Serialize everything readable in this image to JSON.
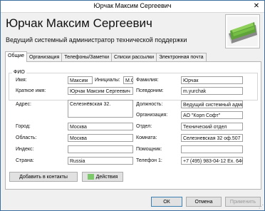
{
  "window": {
    "title": "Юрчак Максим Сергеевич",
    "close_glyph": "✕"
  },
  "header": {
    "name": "Юрчак Максим Сергеевич",
    "job_title": "Ведущий системный администратор технической поддержки"
  },
  "tabs": [
    {
      "label": "Общие",
      "active": true
    },
    {
      "label": "Организация"
    },
    {
      "label": "Телефоны/Заметки"
    },
    {
      "label": "Списки рассылки"
    },
    {
      "label": "Электронная почта"
    }
  ],
  "fio": {
    "legend": "ФИО",
    "first_name_label": "Имя:",
    "first_name": "Максим",
    "initials_label": "Инициалы:",
    "initials": "М.С.",
    "last_name_label": "Фамилия:",
    "last_name": "Юрчак",
    "display_name_label": "Краткое имя:",
    "display_name": "Юрчак Максим Сергеевич",
    "alias_label": "Псевдоним:",
    "alias": "m.yurchak"
  },
  "address": {
    "address_label": "Адрес:",
    "address": "Селезнёвская 32.",
    "city_label": "Город:",
    "city": "Москва",
    "region_label": "Область:",
    "region": "Москва",
    "zip_label": "Индекс:",
    "zip": "",
    "country_label": "Страна:",
    "country": "Russia"
  },
  "work": {
    "position_label": "Должность:",
    "position": "Ведущий системный администратор",
    "org_label": "Организация:",
    "org": "АО \"Корп Софт\"",
    "dept_label": "Отдел:",
    "dept": "Технический отдел",
    "room_label": "Комната:",
    "room": "Селезневская 32 оф.507",
    "assistant_label": "Помощник:",
    "assistant": "",
    "phone_label": "Телефон 1:",
    "phone": "+7 (495) 983-04-12 Ex. 6467"
  },
  "panel_buttons": {
    "add_contacts": "Добавить в контакты",
    "actions": "Действия"
  },
  "footer": {
    "ok": "ОК",
    "cancel": "Отмена",
    "apply": "Применить"
  }
}
